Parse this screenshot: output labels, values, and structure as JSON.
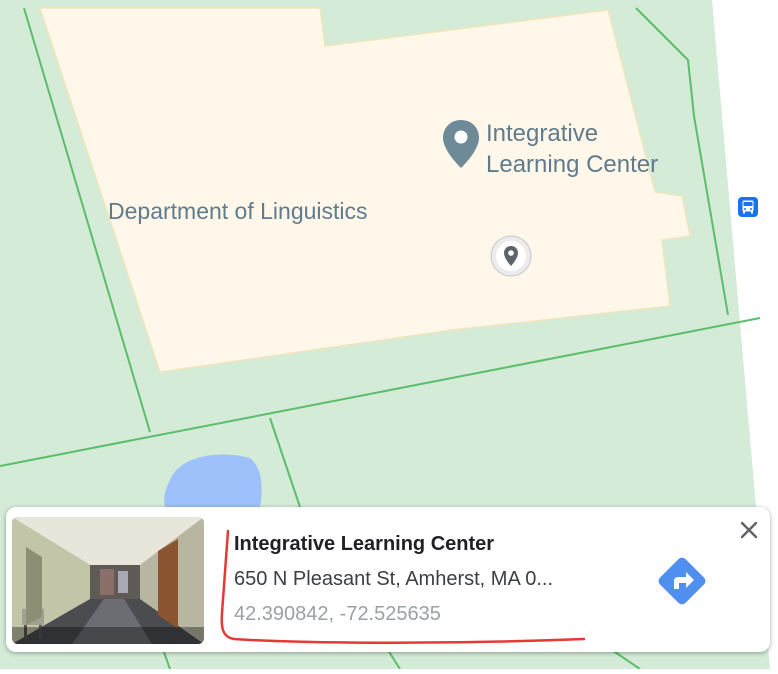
{
  "map": {
    "labels": {
      "department": "Department of Linguistics",
      "place_line1": "Integrative",
      "place_line2": "Learning Center"
    },
    "icons": {
      "place_pin": "map-pin-icon",
      "dropped_marker": "dropped-marker-icon",
      "transit": "bus-stop-icon"
    },
    "colors": {
      "park": "#d3ebd7",
      "building": "#fff8ea",
      "path": "#5cbd6b",
      "water": "#9fc1fb",
      "label": "#5f7b8c"
    }
  },
  "info_card": {
    "place_name": "Integrative Learning Center",
    "address": "650 N Pleasant St, Amherst, MA 0...",
    "coordinates": "42.390842, -72.525635",
    "photo_icon": "street-view-photo",
    "directions_icon": "directions-icon",
    "close_icon": "close-icon",
    "annotation_color": "#e53935",
    "directions_color": "#4f8ff0"
  }
}
